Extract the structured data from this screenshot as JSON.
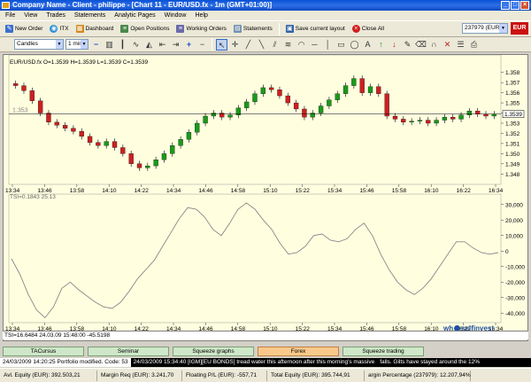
{
  "window": {
    "title": "Company Name - Client - philippe - [Chart 11 - EUR/USD.fx - 1m (GMT+01:00)]"
  },
  "menu": [
    "File",
    "View",
    "Trades",
    "Statements",
    "Analytic Pages",
    "Window",
    "Help"
  ],
  "toolbar": {
    "new_order": "New Order",
    "itx": "ITX",
    "dashboard": "Dashboard",
    "open_positions": "Open Positions",
    "working_orders": "Working Orders",
    "statements": "Statements",
    "save_layout": "Save current layout",
    "close_all": "Close All",
    "account": "237979 (EUR)",
    "currency_flag": "EUR"
  },
  "chart_toolbar": {
    "chart_type": "Candles",
    "interval": "1 min"
  },
  "price_header": "EUR/USD.fx O=1.3539 H=1.3539 L=1.3539 C=1.3539",
  "price_line_label": "1.353",
  "last_price_tag": "1.3539",
  "tsi_header": "TSI=0.1843  25.13",
  "status_row": "TSI=16.6484  24.03.09  15:48:00  -45.5198",
  "tabs": [
    "TACursus",
    "Seminar",
    "Squeeze graphs",
    "Forex",
    "Squeeze trading"
  ],
  "active_tab": "Forex",
  "ticker": [
    "24/03/2009 14:20:25 Portfolio modified. Code: 53",
    "24/03/2009 15:34:40 [IGM][EU BONDS] tread water this afternoon after this morning's massive",
    "falls.  Gilts have stayed around the 12%"
  ],
  "statusbar": {
    "avl_equity": "Avl. Equity (EUR): 392.503,21",
    "margin_req": "Margin Req (EUR): 3.241,70",
    "floating_pl": "Floating P/L (EUR): -557,71",
    "total_equity": "Total Equity (EUR): 395.744,91",
    "margin_pct": "argin Percentage (237979): 12.207,94%"
  },
  "brand": {
    "prefix": "wh",
    "name": "selfinvest"
  },
  "colors": {
    "up": "#1a9a1a",
    "down": "#cc2020",
    "bg": "#ffffe0",
    "tsi_line": "#888888"
  },
  "chart_data": [
    {
      "type": "candlestick",
      "title": "EUR/USD.fx",
      "x": [
        "13:34",
        "13:46",
        "13:58",
        "14:10",
        "14:22",
        "14:34",
        "14:46",
        "14:58",
        "15:10",
        "15:22",
        "15:34",
        "15:46",
        "15:58",
        "16:10",
        "16:22",
        "16:34"
      ],
      "y_ticks": [
        1.348,
        1.349,
        1.35,
        1.351,
        1.352,
        1.353,
        1.354,
        1.355,
        1.356,
        1.357,
        1.358
      ],
      "ylim": [
        1.3475,
        1.3585
      ],
      "close": [
        1.3567,
        1.3562,
        1.3552,
        1.354,
        1.3531,
        1.3528,
        1.3525,
        1.3522,
        1.3517,
        1.3511,
        1.3508,
        1.3512,
        1.3506,
        1.35,
        1.349,
        1.3486,
        1.3488,
        1.3494,
        1.35,
        1.3508,
        1.3514,
        1.3521,
        1.353,
        1.3537,
        1.354,
        1.3536,
        1.3538,
        1.3545,
        1.3551,
        1.3559,
        1.3565,
        1.3563,
        1.3557,
        1.355,
        1.3544,
        1.3536,
        1.354,
        1.3547,
        1.3553,
        1.3559,
        1.3567,
        1.3574,
        1.356,
        1.3566,
        1.3559,
        1.3537,
        1.3534,
        1.3531,
        1.3532,
        1.3533,
        1.353,
        1.3533,
        1.3536,
        1.3534,
        1.3538,
        1.3542,
        1.3539,
        1.3537,
        1.3539
      ],
      "last": 1.3539
    },
    {
      "type": "line",
      "title": "TSI",
      "x": [
        "13:34",
        "13:46",
        "13:58",
        "14:10",
        "14:22",
        "14:34",
        "14:46",
        "14:58",
        "15:10",
        "15:22",
        "15:34",
        "15:46",
        "15:58",
        "16:10",
        "16:22",
        "16:34"
      ],
      "y_ticks": [
        30000,
        20000,
        10000,
        0,
        -10000,
        -20000,
        -30000,
        -40000
      ],
      "ylim": [
        -45000,
        35000
      ],
      "values": [
        -5000,
        -15000,
        -28000,
        -38000,
        -43000,
        -36000,
        -24000,
        -20000,
        -25000,
        -29000,
        -33000,
        -36000,
        -37000,
        -33000,
        -26000,
        -18000,
        -12000,
        -6000,
        3000,
        12000,
        21000,
        28000,
        27000,
        22000,
        14000,
        10000,
        18000,
        27000,
        31000,
        27000,
        20000,
        14000,
        5000,
        -2000,
        -1000,
        3000,
        10000,
        11000,
        7000,
        6000,
        8000,
        14000,
        18000,
        10000,
        -2000,
        -12000,
        -20000,
        -25000,
        -28000,
        -24000,
        -18000,
        -10000,
        -2000,
        6000,
        6000,
        2000,
        -1000,
        -2000,
        -1000
      ]
    }
  ]
}
